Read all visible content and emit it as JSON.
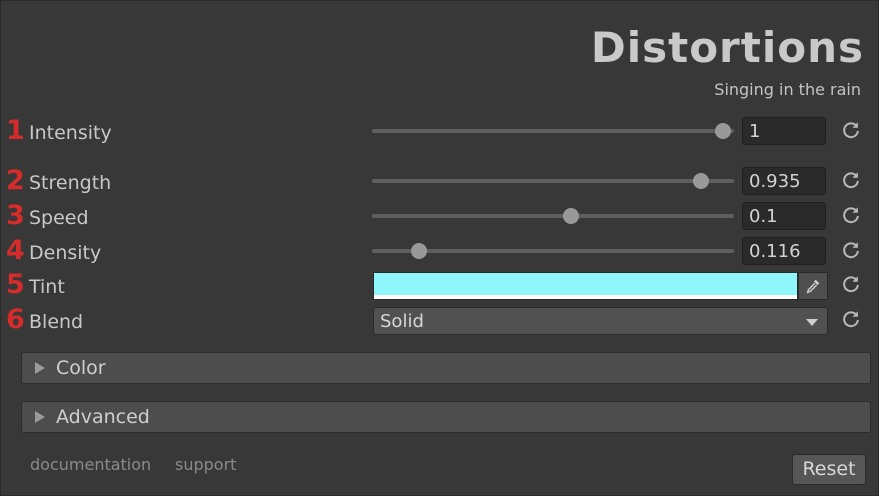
{
  "header": {
    "title": "Distortions",
    "subtitle": "Singing in the rain"
  },
  "properties": [
    {
      "num": "1",
      "label": "Intensity",
      "type": "slider",
      "value": "1",
      "fraction": 0.97
    },
    {
      "num": "2",
      "label": "Strength",
      "type": "slider",
      "value": "0.935",
      "fraction": 0.91
    },
    {
      "num": "3",
      "label": "Speed",
      "type": "slider",
      "value": "0.1",
      "fraction": 0.55
    },
    {
      "num": "4",
      "label": "Density",
      "type": "slider",
      "value": "0.116",
      "fraction": 0.13
    },
    {
      "num": "5",
      "label": "Tint",
      "type": "color",
      "color": "#8ff7fb"
    },
    {
      "num": "6",
      "label": "Blend",
      "type": "dropdown",
      "value": "Solid"
    }
  ],
  "sections": [
    {
      "label": "Color",
      "expanded": false
    },
    {
      "label": "Advanced",
      "expanded": false
    }
  ],
  "footer": {
    "documentation_label": "documentation",
    "support_label": "support",
    "reset_label": "Reset"
  },
  "icons": {
    "reset": "reset-icon",
    "picker": "eyedropper-icon",
    "expand": "triangle-right-icon",
    "dropdown": "chevron-down-icon"
  },
  "colors": {
    "number_accent": "#d42b2b",
    "tint": "#8ff7fb"
  }
}
